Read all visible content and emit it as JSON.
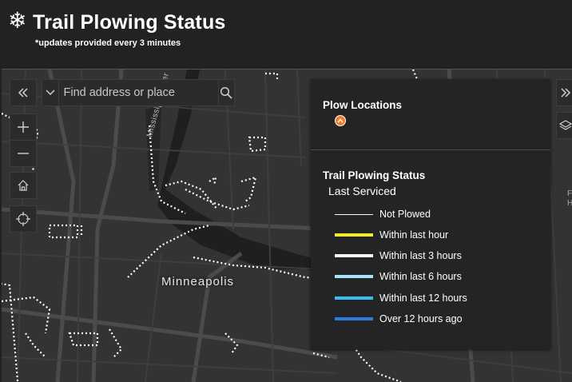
{
  "header": {
    "logo_icon": "snowflake-icon",
    "logo_glyph": "❄",
    "title": "Trail Plowing Status",
    "subtitle": "*updates provided every 3 minutes"
  },
  "map": {
    "city_label": "Minneapolis",
    "river_label": "Mississippi River",
    "edge_text_1": "F",
    "edge_text_2": "H",
    "colors": {
      "background": "#333333",
      "roads": "#4a4a4a",
      "water": "#1e1e1e",
      "trails": "#ffffff"
    }
  },
  "controls": {
    "collapse_icon": "double-chevron-left-icon",
    "expand_icon": "double-chevron-right-icon",
    "zoom_in_icon": "plus-icon",
    "zoom_out_icon": "minus-icon",
    "home_icon": "home-icon",
    "locate_icon": "crosshair-icon",
    "layers_icon": "layers-icon"
  },
  "search": {
    "placeholder": "Find address or place",
    "dropdown_icon": "caret-down-icon",
    "search_icon": "search-icon"
  },
  "legend": {
    "plow_title": "Plow Locations",
    "plow_marker_color": "#f07c2d",
    "trail_title": "Trail Plowing Status",
    "sublabel": "Last Serviced",
    "items": [
      {
        "label": "Not Plowed",
        "color": "#ffffff",
        "style": "thin"
      },
      {
        "label": "Within last hour",
        "color": "#f5ea2e",
        "style": "thick"
      },
      {
        "label": "Within last 3 hours",
        "color": "#f1fafd",
        "style": "thick"
      },
      {
        "label": "Within last 6 hours",
        "color": "#a6e3fb",
        "style": "thick"
      },
      {
        "label": "Within last 12 hours",
        "color": "#39bdf2",
        "style": "thick"
      },
      {
        "label": "Over 12 hours ago",
        "color": "#2a7de0",
        "style": "thick"
      }
    ]
  }
}
